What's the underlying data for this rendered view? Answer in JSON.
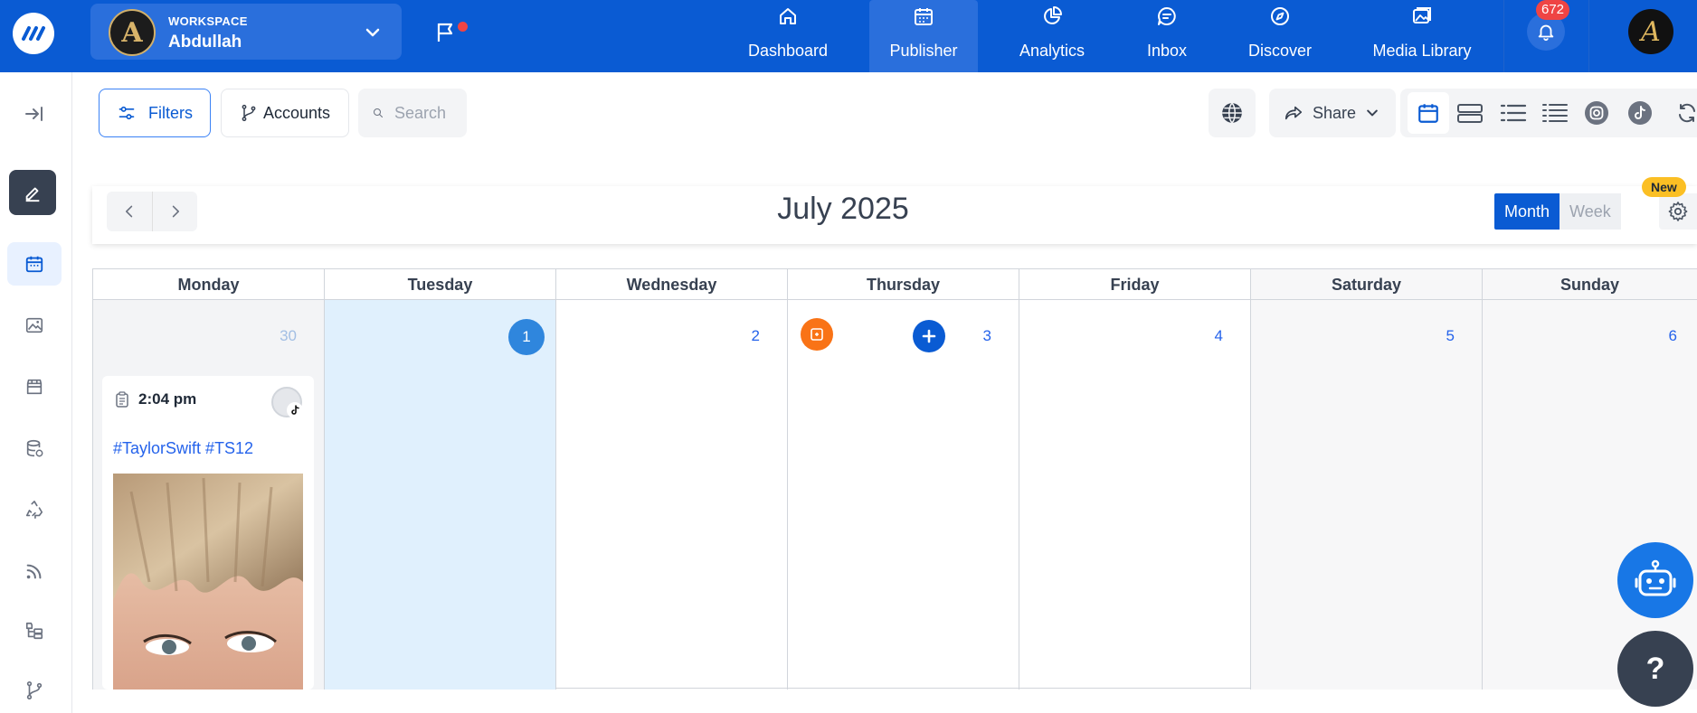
{
  "workspace": {
    "label": "WORKSPACE",
    "name": "Abdullah",
    "avatar_letter": "A"
  },
  "nav": [
    {
      "label": "Dashboard",
      "icon": "home-icon"
    },
    {
      "label": "Publisher",
      "icon": "calendar-icon",
      "active": true
    },
    {
      "label": "Analytics",
      "icon": "pie-chart-icon"
    },
    {
      "label": "Inbox",
      "icon": "chat-icon"
    },
    {
      "label": "Discover",
      "icon": "compass-icon"
    },
    {
      "label": "Media Library",
      "icon": "image-icon"
    }
  ],
  "notifications": {
    "count": "672"
  },
  "user": {
    "avatar_letter": "A"
  },
  "toolbar": {
    "filters_label": "Filters",
    "accounts_label": "Accounts",
    "search_placeholder": "Search",
    "share_label": "Share"
  },
  "calendar": {
    "title": "July 2025",
    "views": {
      "month": "Month",
      "week": "Week"
    },
    "new_badge": "New",
    "days": [
      {
        "name": "Monday",
        "num": "30"
      },
      {
        "name": "Tuesday",
        "num": "1"
      },
      {
        "name": "Wednesday",
        "num": "2"
      },
      {
        "name": "Thursday",
        "num": "3"
      },
      {
        "name": "Friday",
        "num": "4"
      },
      {
        "name": "Saturday",
        "num": "5"
      },
      {
        "name": "Sunday",
        "num": "6"
      }
    ]
  },
  "post": {
    "time": "2:04 pm",
    "caption": "#TaylorSwift #TS12"
  },
  "help": {
    "label": "?"
  },
  "colors": {
    "primary": "#0a5bd3",
    "today": "#2f86dd",
    "draft": "#f97316",
    "badge": "#ef4444",
    "new": "#fbbf24"
  }
}
